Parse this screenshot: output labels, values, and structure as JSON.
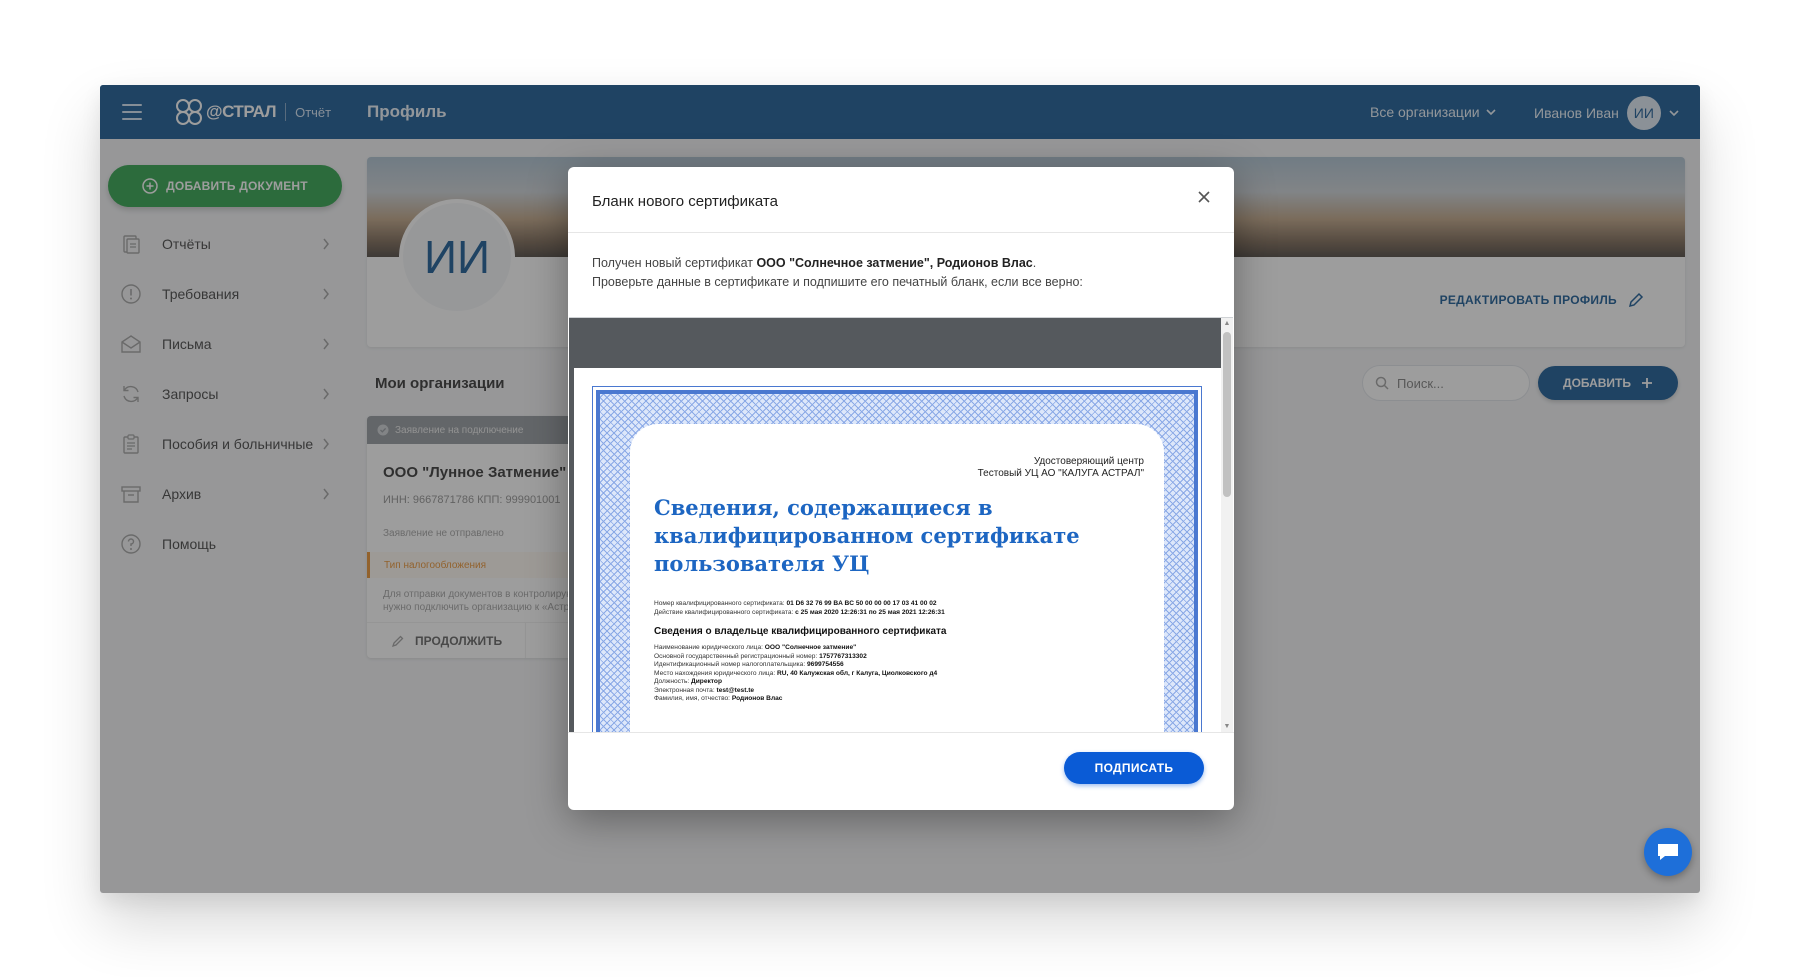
{
  "topbar": {
    "logo_text": "@СТРАЛ",
    "logo_sub": "Отчёт",
    "page_title": "Профиль",
    "org_switch": "Все организации",
    "user_name": "Иванов Иван",
    "user_initials": "ИИ"
  },
  "sidebar": {
    "add_document": "ДОБАВИТЬ ДОКУМЕНТ",
    "items": [
      {
        "label": "Отчёты",
        "icon": "report-icon"
      },
      {
        "label": "Требования",
        "icon": "alert-circle-icon"
      },
      {
        "label": "Письма",
        "icon": "envelope-icon"
      },
      {
        "label": "Запросы",
        "icon": "refresh-icon"
      },
      {
        "label": "Пособия и больничные",
        "icon": "clipboard-icon"
      },
      {
        "label": "Архив",
        "icon": "archive-icon"
      },
      {
        "label": "Помощь",
        "icon": "help-icon"
      }
    ]
  },
  "profile": {
    "initials": "ИИ",
    "edit_label": "РЕДАКТИРОВАТЬ ПРОФИЛЬ"
  },
  "organizations": {
    "title": "Мои организации",
    "search_placeholder": "Поиск...",
    "add_label": "ДОБАВИТЬ",
    "card": {
      "status": "Заявление на подключение",
      "name": "ООО \"Лунное Затмение\"",
      "ids": "ИНН: 9667871786  КПП: 999901001",
      "line1": "Заявление не отправлено",
      "tax": "Тип налогообложения",
      "note": "Для отправки документов в контролирующие органы нужно подключить организацию к «Астрал Отчёт»",
      "continue": "ПРОДОЛЖИТЬ"
    }
  },
  "modal": {
    "title": "Бланк нового сертификата",
    "text_prefix": "Получен новый сертификат ",
    "text_bold": "ООО \"Солнечное затмение\", Родионов Влас",
    "text_suffix": ".",
    "text_line2": "Проверьте данные в сертификате и подпишите его печатный бланк, если все верно:",
    "sign_label": "ПОДПИСАТЬ",
    "certificate": {
      "authority_line1": "Удостоверяющий центр",
      "authority_line2": "Тестовый УЦ АО \"КАЛУГА АСТРАЛ\"",
      "title": "Сведения, содержащиеся в квалифицированном сертификате пользователя УЦ",
      "serial_label": "Номер квалифицированного сертификата: ",
      "serial": "01 D6 32 76 99 BA BC 50 00 00 00 17 03 41 00 02",
      "validity_label": "Действие квалифицированного сертификата: ",
      "validity": "с 25 мая 2020 12:26:31 по 25 мая 2021 12:26:31",
      "owner_heading": "Сведения о владельце квалифицированного сертификата",
      "fields": [
        {
          "label": "Наименование юридического лица: ",
          "value": "ООО \"Солнечное затмение\""
        },
        {
          "label": "Основной государственный регистрационный номер: ",
          "value": "1757767313302"
        },
        {
          "label": "Идентификационный номер налогоплательщика: ",
          "value": "9699754556"
        },
        {
          "label": "Место нахождения юридического лица: ",
          "value": "RU, 40 Калужская обл, г Калуга, Циолковского д4"
        },
        {
          "label": "Должность: ",
          "value": "Директор"
        },
        {
          "label": "Электронная почта: ",
          "value": "test@test.te"
        },
        {
          "label": "Фамилия, имя, отчество: ",
          "value": "Родионов Влас"
        }
      ]
    }
  },
  "colors": {
    "topbar": "#034a8a",
    "add_document": "#1d9a3c",
    "sign_button": "#0a5bd6",
    "certificate_blue": "#1d66c2"
  }
}
